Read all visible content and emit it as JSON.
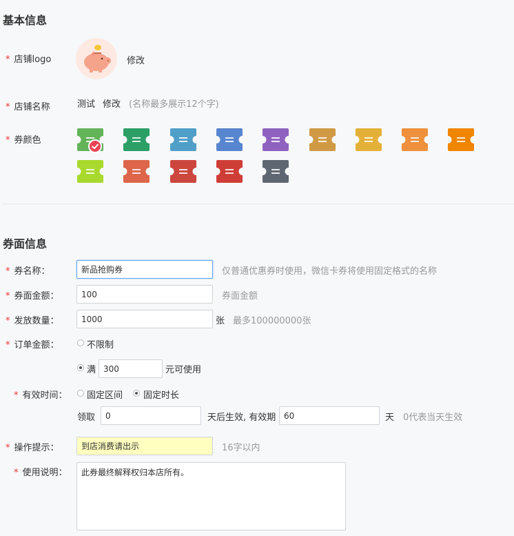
{
  "basic": {
    "title": "基本信息",
    "logo_label": "店铺logo",
    "logo_modify": "修改",
    "name_label": "店铺名称",
    "name_value": "测试",
    "name_modify": "修改",
    "name_hint": "(名称最多展示12个字)",
    "color_label": "券颜色",
    "colors": [
      "#63b359",
      "#2c9f67",
      "#509fc9",
      "#5885cf",
      "#9062c0",
      "#d09a45",
      "#e4b138",
      "#ee903c",
      "#f08500",
      "#a9d92d",
      "#dd6549",
      "#cc463d",
      "#cf3e36",
      "#5e6671"
    ],
    "selected_color_index": 0
  },
  "coupon": {
    "title": "券面信息",
    "name_label": "券名称：",
    "name_value": "新品抢购券",
    "name_hint": "仅普通优惠券时使用，微信卡券将使用固定格式的名称",
    "amount_label": "券面金额：",
    "amount_value": "100",
    "amount_hint": "券面金额",
    "qty_label": "发放数量：",
    "qty_value": "1000",
    "qty_unit": "张",
    "qty_hint": "最多100000000张",
    "order_label": "订单金额：",
    "order_unlimited": "不限制",
    "order_full": "满",
    "order_full_value": "300",
    "order_full_suffix": "元可使用",
    "valid_label": "有效时间：",
    "valid_range": "固定区间",
    "valid_duration": "固定时长",
    "receive_prefix": "领取",
    "receive_value": "0",
    "receive_mid": "天后生效, 有效期",
    "valid_days_value": "60",
    "valid_days_unit": "天",
    "valid_hint": "0代表当天生效",
    "tip_label": "操作提示：",
    "tip_value": "到店消费请出示",
    "tip_hint": "16字以内",
    "desc_label": "使用说明：",
    "desc_value": "此券最终解释权归本店所有。"
  }
}
